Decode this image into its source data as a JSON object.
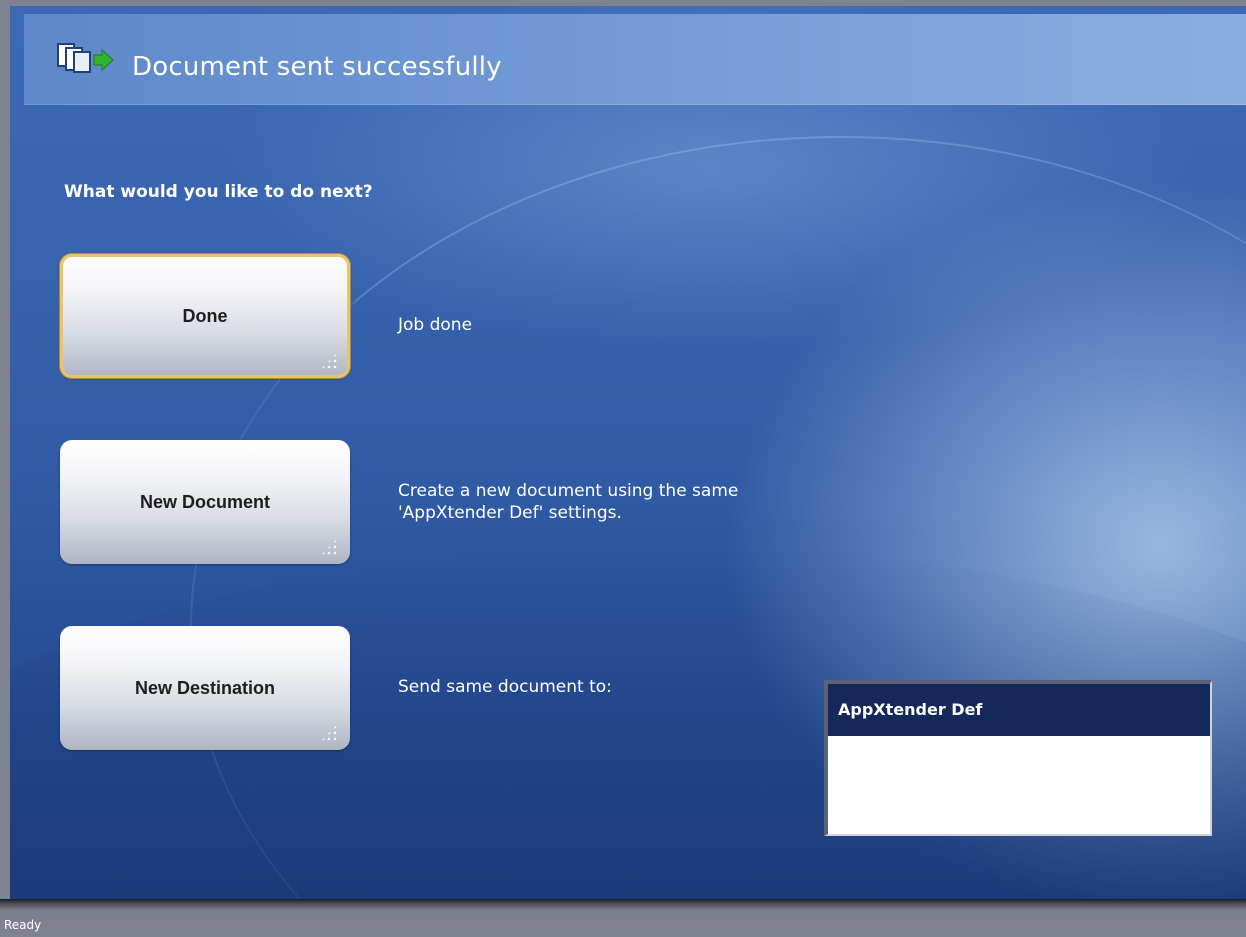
{
  "window": {
    "title": "Document sent successfully",
    "title_icon": "send-document-icon"
  },
  "prompt": "What would you like to do next?",
  "actions": [
    {
      "label": "Done",
      "description": "Job done",
      "focused": true
    },
    {
      "label": "New Document",
      "description": "Create a new document using the same 'AppXtender Def' settings."
    },
    {
      "label": "New Destination",
      "description": "Send same document to:"
    }
  ],
  "destinations": {
    "items": [
      "AppXtender Def"
    ],
    "selected": "AppXtender Def"
  },
  "status_bar": {
    "text": "Ready"
  },
  "colors": {
    "background": "#3762ad",
    "selection": "#15285c",
    "focus_ring": "#e8c46e",
    "icon_arrow": "#2db52d"
  }
}
